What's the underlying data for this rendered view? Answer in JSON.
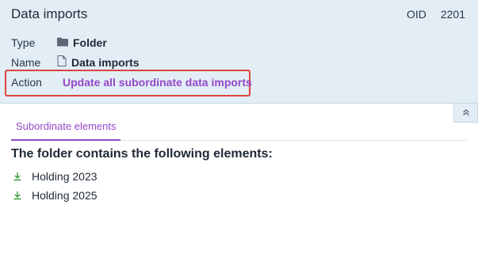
{
  "header": {
    "title": "Data imports",
    "oid_label": "OID",
    "oid_value": "2201"
  },
  "properties": {
    "type_label": "Type",
    "type_value": "Folder",
    "name_label": "Name",
    "name_value": "Data imports",
    "action_label": "Action",
    "action_link": "Update all subordinate data imports"
  },
  "tabs": [
    {
      "label": "Subordinate elements",
      "active": true
    }
  ],
  "content": {
    "heading": "The folder contains the following elements:",
    "items": [
      {
        "label": "Holding 2023",
        "icon": "download-icon"
      },
      {
        "label": "Holding 2025",
        "icon": "download-icon"
      }
    ]
  },
  "colors": {
    "header_bg": "#e2edf5",
    "accent": "#9547c9",
    "highlight_box": "#e0433c",
    "item_icon": "#3a9a3a"
  }
}
